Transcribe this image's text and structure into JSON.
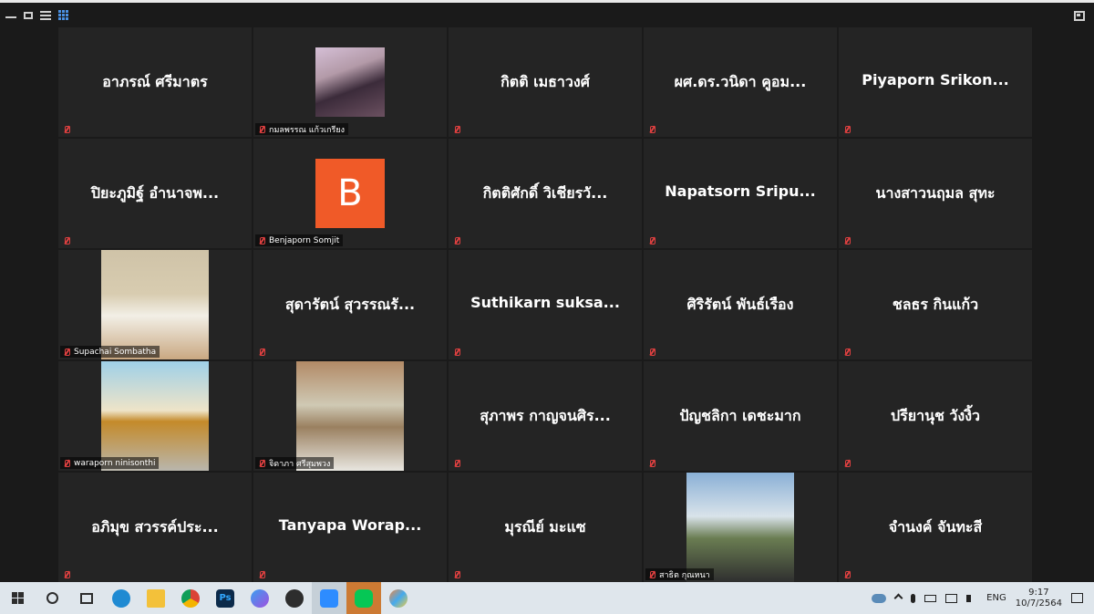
{
  "window": {
    "toolbar_icons": [
      "minimize-icon",
      "restore-icon",
      "speaker-view-icon",
      "gallery-view-icon"
    ],
    "exit_icon": "exit-fullscreen-icon"
  },
  "participants": [
    {
      "name": "อาภรณ์ ศรีมาตร",
      "label": "",
      "video": false
    },
    {
      "name": "",
      "label": "กมลพรรณ แก้วเกรียง",
      "video": true
    },
    {
      "name": "กิตติ เมธาวงศ์",
      "label": "",
      "video": false
    },
    {
      "name": "ผศ.ดร.วนิดา คูอม...",
      "label": "",
      "video": false
    },
    {
      "name": "Piyaporn  Srikon...",
      "label": "",
      "video": false
    },
    {
      "name": "ปิยะภูมิฐ์ อำนาจพ...",
      "label": "",
      "video": false
    },
    {
      "name": "",
      "label": "Benjaporn Somjit",
      "avatar": "B",
      "avatar_color": "#f05a28"
    },
    {
      "name": "กิตติศักดิ์ วิเชียรวั...",
      "label": "",
      "video": false
    },
    {
      "name": "Napatsorn  Sripu...",
      "label": "",
      "video": false
    },
    {
      "name": "นางสาวนฤมล สุทะ",
      "label": "",
      "video": false
    },
    {
      "name": "",
      "label": "Supachai Sombatha",
      "video": true
    },
    {
      "name": "สุดารัตน์ สุวรรณรั...",
      "label": "",
      "video": false
    },
    {
      "name": "Suthikarn  suksa...",
      "label": "",
      "video": false
    },
    {
      "name": "ศิริรัตน์ พันธ์เรือง",
      "label": "",
      "video": false
    },
    {
      "name": "ชลธร กินแก้ว",
      "label": "",
      "video": false
    },
    {
      "name": "",
      "label": "waraporn ninisonthi",
      "video": true
    },
    {
      "name": "",
      "label": "จิดาภา ศรีสุมพวง",
      "video": true
    },
    {
      "name": "สุภาพร กาญจนศิร...",
      "label": "",
      "video": false
    },
    {
      "name": "ปัญชลิกา เดชะมาก",
      "label": "",
      "video": false
    },
    {
      "name": "ปรียานุช วังงิ้ว",
      "label": "",
      "video": false
    },
    {
      "name": "อภิมุข สวรรค์ประ...",
      "label": "",
      "video": false
    },
    {
      "name": "Tanyapa  Worap...",
      "label": "",
      "video": false
    },
    {
      "name": "มุรณีย์ มะแซ",
      "label": "",
      "video": false
    },
    {
      "name": "",
      "label": "สาธิต กุณหนา",
      "video": true
    },
    {
      "name": "จำนงค์ จันทะสี",
      "label": "",
      "video": false
    }
  ],
  "taskbar": {
    "apps": [
      "windows-start-icon",
      "search-icon",
      "task-view-icon",
      "edge-icon",
      "file-explorer-icon",
      "chrome-icon",
      "photoshop-icon",
      "copilot-icon",
      "obs-icon",
      "zoom-icon",
      "line-icon",
      "paint-icon"
    ],
    "ps_label": "Ps",
    "lang": "ENG",
    "time": "9:17",
    "date": "10/7/2564"
  }
}
